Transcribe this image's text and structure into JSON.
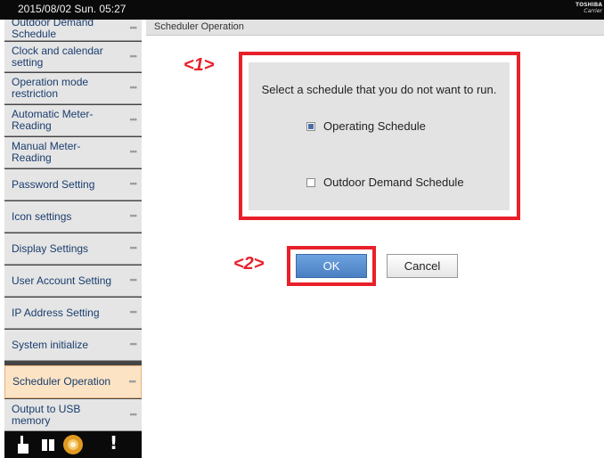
{
  "status_bar": {
    "datetime": "2015/08/02 Sun. 05:27",
    "brand_line1": "TOSHIBA",
    "brand_line2": "Carrier"
  },
  "sidebar": {
    "items": [
      {
        "label": "Outdoor Demand Schedule",
        "active": false
      },
      {
        "label": "Clock and calendar setting",
        "active": false
      },
      {
        "label": "Operation mode restriction",
        "active": false
      },
      {
        "label": "Automatic Meter-Reading",
        "active": false
      },
      {
        "label": "Manual Meter-Reading",
        "active": false
      },
      {
        "label": "Password Setting",
        "active": false
      },
      {
        "label": "Icon settings",
        "active": false
      },
      {
        "label": "Display Settings",
        "active": false
      },
      {
        "label": "User Account Setting",
        "active": false
      },
      {
        "label": "IP Address Setting",
        "active": false
      },
      {
        "label": "System initialize",
        "active": false
      },
      {
        "label": "Scheduler Operation",
        "active": true
      },
      {
        "label": "Output to USB memory",
        "active": false
      }
    ],
    "dots": "•••"
  },
  "bottom_bar": {
    "icons": [
      "hand-pointer-icon",
      "pause-icon",
      "sun-gear-icon",
      "alert-icon"
    ],
    "alert_glyph": "!"
  },
  "main": {
    "header_title": "Scheduler Operation",
    "prompt": "Select a schedule that you do not want to run.",
    "options": [
      {
        "label": "Operating Schedule",
        "checked": true
      },
      {
        "label": "Outdoor Demand Schedule",
        "checked": false
      }
    ],
    "ok_label": "OK",
    "cancel_label": "Cancel"
  },
  "annotations": {
    "marker1": "<1>",
    "marker2": "<2>",
    "highlight_color": "#e8202a"
  }
}
